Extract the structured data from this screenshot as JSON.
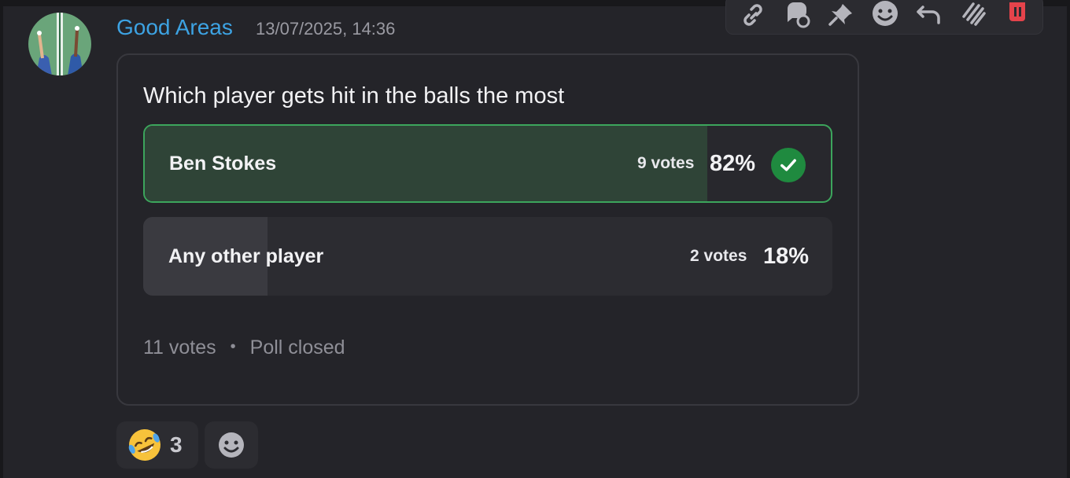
{
  "message": {
    "author": "Good Areas",
    "timestamp": "13/07/2025, 14:36"
  },
  "toolbar": {
    "icons": [
      "link-icon",
      "thread-icon",
      "pin-icon",
      "add-reaction-icon",
      "reply-icon",
      "more-icon",
      "delete-icon"
    ]
  },
  "poll": {
    "question": "Which player gets hit in the balls the most",
    "options": [
      {
        "label": "Ben Stokes",
        "votes": "9 votes",
        "percent": "82%",
        "fraction": 0.82,
        "winner": true
      },
      {
        "label": "Any other player",
        "votes": "2 votes",
        "percent": "18%",
        "fraction": 0.18,
        "winner": false
      }
    ],
    "total_votes": "11 votes",
    "separator": "•",
    "status": "Poll closed"
  },
  "reactions": [
    {
      "emoji": "rolling-on-floor-laughing",
      "count": "3"
    }
  ],
  "colors": {
    "author": "#3da3e3",
    "winner_border": "#3ca55c",
    "check": "#1f8a3f",
    "delete": "#e5434b"
  }
}
